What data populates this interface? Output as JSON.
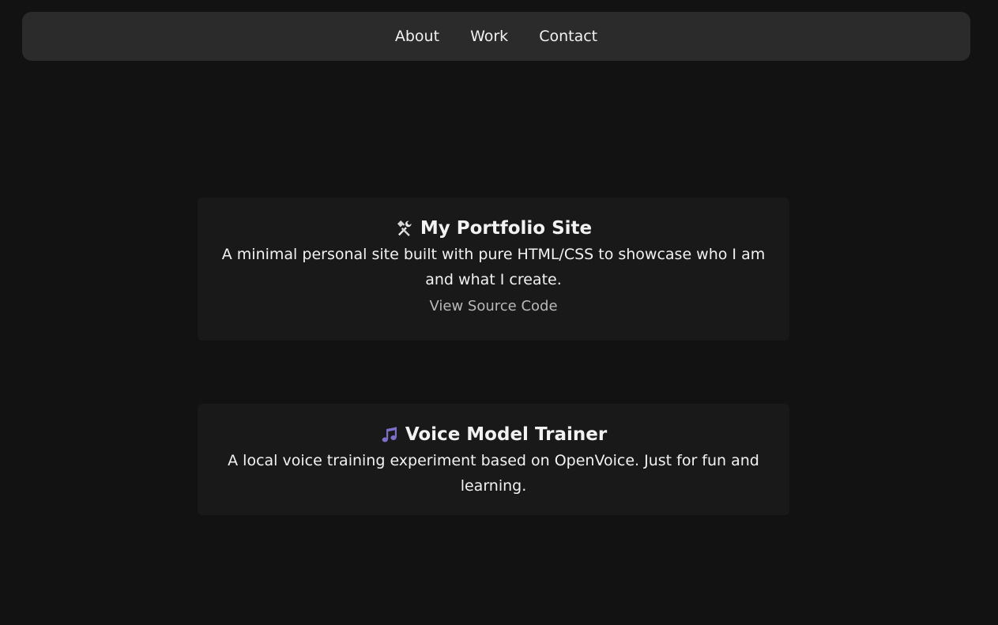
{
  "nav": {
    "items": [
      {
        "label": "About"
      },
      {
        "label": "Work"
      },
      {
        "label": "Contact"
      }
    ]
  },
  "projects": [
    {
      "icon": "hammer-and-wrench-icon",
      "title": "My Portfolio Site",
      "description": "A minimal personal site built with pure HTML/CSS to showcase who I am and what I create.",
      "link_label": "View Source Code"
    },
    {
      "icon": "music-notes-icon",
      "title": "Voice Model Trainer",
      "description": "A local voice training experiment based on OpenVoice. Just for fun and learning."
    }
  ],
  "colors": {
    "background": "#121212",
    "navbar": "#2b2b2b",
    "card": "#191919",
    "text": "#f2f2f2",
    "link_muted": "#b9b9b9",
    "music_icon": "#7b6fc9"
  }
}
